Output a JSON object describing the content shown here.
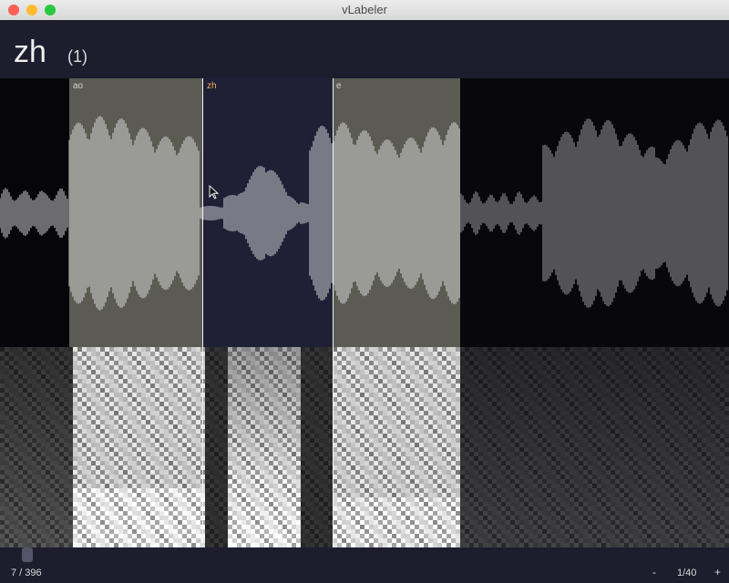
{
  "window": {
    "title": "vLabeler"
  },
  "entry": {
    "name": "zh",
    "index": "(1)"
  },
  "segments": [
    {
      "label": "ao"
    },
    {
      "label": "zh"
    },
    {
      "label": "e"
    }
  ],
  "colors": {
    "segment_fixed": "#5b5a53",
    "segment_current": "#1f1f36",
    "current_label": "#f1b155",
    "background": "#1d1c2c"
  },
  "footer": {
    "progress": "7 / 396",
    "zoom_out": "-",
    "zoom_level": "1/40",
    "zoom_in": "+"
  }
}
